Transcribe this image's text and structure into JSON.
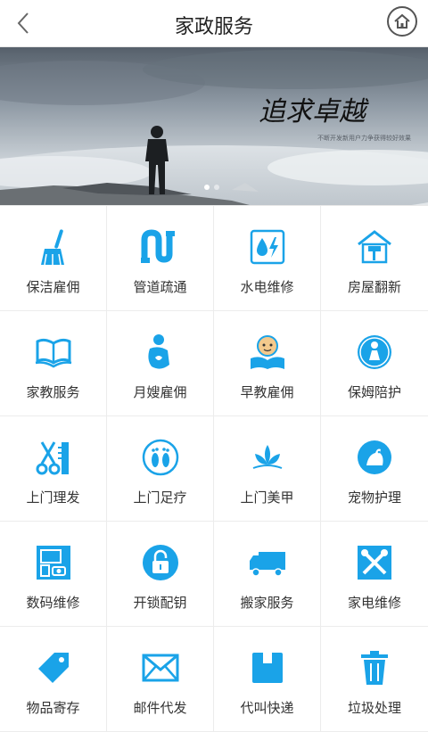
{
  "header": {
    "title": "家政服务",
    "back_icon": "chevron-left-icon",
    "home_icon": "home-icon"
  },
  "banner": {
    "calligraphy": "追求卓越",
    "tagline": "不断开发新用户力争获得较好效果"
  },
  "accent": "#1aa3e8",
  "grid": {
    "items": [
      {
        "label": "保洁雇佣",
        "icon": "broom-icon"
      },
      {
        "label": "管道疏通",
        "icon": "pipe-icon"
      },
      {
        "label": "水电维修",
        "icon": "water-electric-icon"
      },
      {
        "label": "房屋翻新",
        "icon": "house-paint-icon"
      },
      {
        "label": "家教服务",
        "icon": "open-book-icon"
      },
      {
        "label": "月嫂雇佣",
        "icon": "mother-baby-icon"
      },
      {
        "label": "早教雇佣",
        "icon": "child-reading-icon"
      },
      {
        "label": "保姆陪护",
        "icon": "nanny-icon"
      },
      {
        "label": "上门理发",
        "icon": "scissors-comb-icon"
      },
      {
        "label": "上门足疗",
        "icon": "footprints-icon"
      },
      {
        "label": "上门美甲",
        "icon": "lotus-icon"
      },
      {
        "label": "宠物护理",
        "icon": "pet-icon"
      },
      {
        "label": "数码维修",
        "icon": "devices-icon"
      },
      {
        "label": "开锁配钥",
        "icon": "padlock-icon"
      },
      {
        "label": "搬家服务",
        "icon": "truck-icon"
      },
      {
        "label": "家电维修",
        "icon": "tools-icon"
      },
      {
        "label": "物品寄存",
        "icon": "tag-icon"
      },
      {
        "label": "邮件代发",
        "icon": "envelope-icon"
      },
      {
        "label": "代叫快递",
        "icon": "package-icon"
      },
      {
        "label": "垃圾处理",
        "icon": "trash-icon"
      }
    ]
  }
}
